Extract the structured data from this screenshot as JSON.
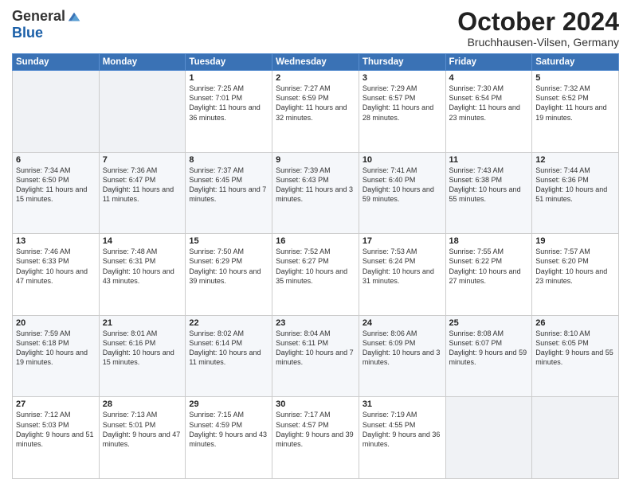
{
  "header": {
    "logo_general": "General",
    "logo_blue": "Blue",
    "month_title": "October 2024",
    "location": "Bruchhausen-Vilsen, Germany"
  },
  "days_of_week": [
    "Sunday",
    "Monday",
    "Tuesday",
    "Wednesday",
    "Thursday",
    "Friday",
    "Saturday"
  ],
  "weeks": [
    [
      {
        "day": "",
        "info": ""
      },
      {
        "day": "",
        "info": ""
      },
      {
        "day": "1",
        "info": "Sunrise: 7:25 AM\nSunset: 7:01 PM\nDaylight: 11 hours and 36 minutes."
      },
      {
        "day": "2",
        "info": "Sunrise: 7:27 AM\nSunset: 6:59 PM\nDaylight: 11 hours and 32 minutes."
      },
      {
        "day": "3",
        "info": "Sunrise: 7:29 AM\nSunset: 6:57 PM\nDaylight: 11 hours and 28 minutes."
      },
      {
        "day": "4",
        "info": "Sunrise: 7:30 AM\nSunset: 6:54 PM\nDaylight: 11 hours and 23 minutes."
      },
      {
        "day": "5",
        "info": "Sunrise: 7:32 AM\nSunset: 6:52 PM\nDaylight: 11 hours and 19 minutes."
      }
    ],
    [
      {
        "day": "6",
        "info": "Sunrise: 7:34 AM\nSunset: 6:50 PM\nDaylight: 11 hours and 15 minutes."
      },
      {
        "day": "7",
        "info": "Sunrise: 7:36 AM\nSunset: 6:47 PM\nDaylight: 11 hours and 11 minutes."
      },
      {
        "day": "8",
        "info": "Sunrise: 7:37 AM\nSunset: 6:45 PM\nDaylight: 11 hours and 7 minutes."
      },
      {
        "day": "9",
        "info": "Sunrise: 7:39 AM\nSunset: 6:43 PM\nDaylight: 11 hours and 3 minutes."
      },
      {
        "day": "10",
        "info": "Sunrise: 7:41 AM\nSunset: 6:40 PM\nDaylight: 10 hours and 59 minutes."
      },
      {
        "day": "11",
        "info": "Sunrise: 7:43 AM\nSunset: 6:38 PM\nDaylight: 10 hours and 55 minutes."
      },
      {
        "day": "12",
        "info": "Sunrise: 7:44 AM\nSunset: 6:36 PM\nDaylight: 10 hours and 51 minutes."
      }
    ],
    [
      {
        "day": "13",
        "info": "Sunrise: 7:46 AM\nSunset: 6:33 PM\nDaylight: 10 hours and 47 minutes."
      },
      {
        "day": "14",
        "info": "Sunrise: 7:48 AM\nSunset: 6:31 PM\nDaylight: 10 hours and 43 minutes."
      },
      {
        "day": "15",
        "info": "Sunrise: 7:50 AM\nSunset: 6:29 PM\nDaylight: 10 hours and 39 minutes."
      },
      {
        "day": "16",
        "info": "Sunrise: 7:52 AM\nSunset: 6:27 PM\nDaylight: 10 hours and 35 minutes."
      },
      {
        "day": "17",
        "info": "Sunrise: 7:53 AM\nSunset: 6:24 PM\nDaylight: 10 hours and 31 minutes."
      },
      {
        "day": "18",
        "info": "Sunrise: 7:55 AM\nSunset: 6:22 PM\nDaylight: 10 hours and 27 minutes."
      },
      {
        "day": "19",
        "info": "Sunrise: 7:57 AM\nSunset: 6:20 PM\nDaylight: 10 hours and 23 minutes."
      }
    ],
    [
      {
        "day": "20",
        "info": "Sunrise: 7:59 AM\nSunset: 6:18 PM\nDaylight: 10 hours and 19 minutes."
      },
      {
        "day": "21",
        "info": "Sunrise: 8:01 AM\nSunset: 6:16 PM\nDaylight: 10 hours and 15 minutes."
      },
      {
        "day": "22",
        "info": "Sunrise: 8:02 AM\nSunset: 6:14 PM\nDaylight: 10 hours and 11 minutes."
      },
      {
        "day": "23",
        "info": "Sunrise: 8:04 AM\nSunset: 6:11 PM\nDaylight: 10 hours and 7 minutes."
      },
      {
        "day": "24",
        "info": "Sunrise: 8:06 AM\nSunset: 6:09 PM\nDaylight: 10 hours and 3 minutes."
      },
      {
        "day": "25",
        "info": "Sunrise: 8:08 AM\nSunset: 6:07 PM\nDaylight: 9 hours and 59 minutes."
      },
      {
        "day": "26",
        "info": "Sunrise: 8:10 AM\nSunset: 6:05 PM\nDaylight: 9 hours and 55 minutes."
      }
    ],
    [
      {
        "day": "27",
        "info": "Sunrise: 7:12 AM\nSunset: 5:03 PM\nDaylight: 9 hours and 51 minutes."
      },
      {
        "day": "28",
        "info": "Sunrise: 7:13 AM\nSunset: 5:01 PM\nDaylight: 9 hours and 47 minutes."
      },
      {
        "day": "29",
        "info": "Sunrise: 7:15 AM\nSunset: 4:59 PM\nDaylight: 9 hours and 43 minutes."
      },
      {
        "day": "30",
        "info": "Sunrise: 7:17 AM\nSunset: 4:57 PM\nDaylight: 9 hours and 39 minutes."
      },
      {
        "day": "31",
        "info": "Sunrise: 7:19 AM\nSunset: 4:55 PM\nDaylight: 9 hours and 36 minutes."
      },
      {
        "day": "",
        "info": ""
      },
      {
        "day": "",
        "info": ""
      }
    ]
  ]
}
